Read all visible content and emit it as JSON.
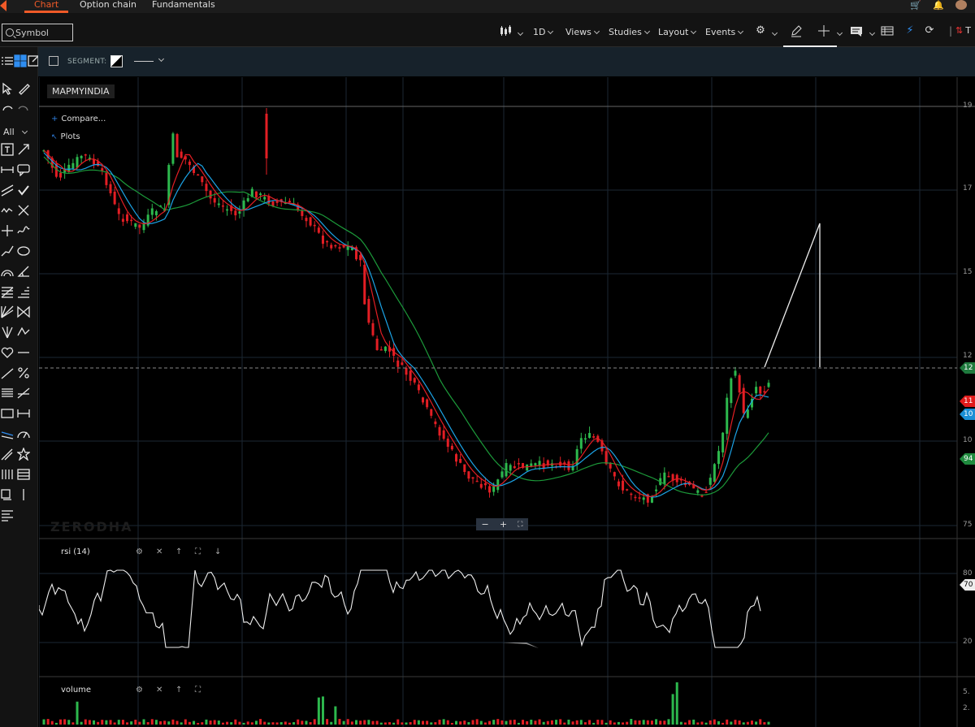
{
  "topnav": {
    "tabs": [
      {
        "label": "Chart",
        "active": true
      },
      {
        "label": "Option chain",
        "active": false
      },
      {
        "label": "Fundamentals",
        "active": false
      }
    ]
  },
  "toolbar": {
    "search_placeholder": "Symbol",
    "interval_label": "1D",
    "views_label": "Views",
    "studies_label": "Studies",
    "layout_label": "Layout",
    "events_label": "Events",
    "trade_partial": "T"
  },
  "sidebar": {
    "filter_label": "All"
  },
  "segment_bar": {
    "label": "SEGMENT:"
  },
  "chart": {
    "symbol": "MAPMYINDIA",
    "compare_label": "Compare...",
    "plots_label": "Plots",
    "watermark": "ZERODHA",
    "zoom_minus": "−",
    "zoom_plus": "+",
    "price_axis_labels": [
      "19",
      "17",
      "15",
      "12",
      "10",
      "75"
    ],
    "price_tags": [
      {
        "text": "12",
        "color": "#1f7a3e"
      },
      {
        "text": "11",
        "color": "#e01b1b"
      },
      {
        "text": "10",
        "color": "#1a8fd6"
      },
      {
        "text": "94",
        "color": "#1f8a3e"
      }
    ],
    "colors": {
      "up_candle": "#2db84d",
      "down_candle": "#e31e24",
      "ma_red": "#e31e24",
      "ma_blue": "#1ca3e6",
      "ma_green": "#1c9a3a"
    }
  },
  "rsi_panel": {
    "title": "rsi (14)",
    "axis_labels": [
      "80",
      "20"
    ],
    "tag": "70"
  },
  "volume_panel": {
    "title": "volume",
    "axis_labels": [
      "5.",
      "2."
    ]
  },
  "chart_data": {
    "type": "candlestick",
    "symbol": "MAPMYINDIA",
    "interval": "1D",
    "indicators": [
      "rsi (14)",
      "volume"
    ],
    "grid": true
  }
}
